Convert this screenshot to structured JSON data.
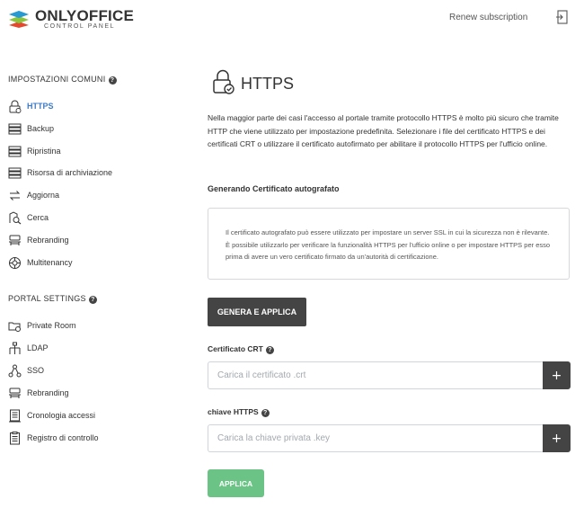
{
  "header": {
    "logo_title": "ONLYOFFICE",
    "logo_subtitle": "CONTROL PANEL",
    "renew_label": "Renew subscription",
    "logout_icon": "logout-icon"
  },
  "sidebar": {
    "common_title": "IMPOSTAZIONI COMUNI",
    "common_items": [
      {
        "label": "HTTPS",
        "icon": "lock-icon",
        "active": true
      },
      {
        "label": "Backup",
        "icon": "server-icon"
      },
      {
        "label": "Ripristina",
        "icon": "server-icon"
      },
      {
        "label": "Risorsa di archiviazione",
        "icon": "server-icon"
      },
      {
        "label": "Aggiorna",
        "icon": "sync-icon"
      },
      {
        "label": "Cerca",
        "icon": "search-icon"
      },
      {
        "label": "Rebranding",
        "icon": "rebranding-icon"
      },
      {
        "label": "Multitenancy",
        "icon": "globe-icon"
      }
    ],
    "portal_title": "PORTAL SETTINGS",
    "portal_items": [
      {
        "label": "Private Room",
        "icon": "private-room-icon"
      },
      {
        "label": "LDAP",
        "icon": "ldap-icon"
      },
      {
        "label": "SSO",
        "icon": "sso-icon"
      },
      {
        "label": "Rebranding",
        "icon": "rebranding-icon"
      },
      {
        "label": "Cronologia accessi",
        "icon": "history-icon"
      },
      {
        "label": "Registro di controllo",
        "icon": "audit-icon"
      }
    ]
  },
  "main": {
    "title": "HTTPS",
    "description": "Nella maggior parte dei casi l'accesso al portale tramite protocollo HTTPS è molto più sicuro che tramite HTTP che viene utilizzato per impostazione predefinita. Selezionare i file del certificato HTTPS e dei certificati CRT o utilizzare il certificato autofirmato per abilitare il protocollo HTTPS per l'ufficio online.",
    "selfsigned_heading": "Generando Certificato autografato",
    "selfsigned_info": "Il certificato autografato può essere utilizzato per impostare un server SSL in cui la sicurezza non è rilevante. È possibile utilizzarlo per verificare la funzionalità HTTPS per l'ufficio online o per impostare HTTPS per esso prima di avere un vero certificato firmato da un'autorità di certificazione.",
    "generate_button": "GENERA E APPLICA",
    "crt_label": "Certificato CRT",
    "crt_placeholder": "Carica il certificato .crt",
    "key_label": "chiave HTTPS",
    "key_placeholder": "Carica la chiave privata .key",
    "plus_label": "+",
    "apply_button": "APPLICA",
    "help_glyph": "?"
  },
  "colors": {
    "accent": "#3d7bc8",
    "dark_button": "#444444",
    "apply_button": "#5fbf7c"
  }
}
